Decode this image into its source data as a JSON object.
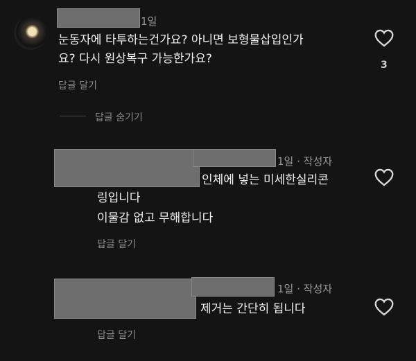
{
  "comments": [
    {
      "time": "1일",
      "text_line1": "눈동자에 타투하는건가요? 아니면 보형물삽입인가",
      "text_line2": "요? 다시 원상복구 가능한가요?",
      "reply_label": "답글 달기",
      "like_count": "3"
    }
  ],
  "hide_replies_label": "답글 숨기기",
  "replies": [
    {
      "meta": "1일 · 작성자",
      "text_line1": "인체에 넣는 미세한실리콘",
      "text_line2": "링입니다",
      "text_line3": "이물감 없고 무해합니다",
      "reply_label": "답글 달기"
    },
    {
      "meta": "1일 · 작성자",
      "text_line1": "제거는 간단히 됩니다",
      "reply_label": "답글 달기"
    }
  ],
  "icons": {
    "like": "heart-outline-icon",
    "avatar": "moon-avatar"
  },
  "colors": {
    "background": "#141414",
    "text": "#f2f2f2",
    "muted": "#9a9a9a",
    "redaction": "#6e6e6e"
  }
}
